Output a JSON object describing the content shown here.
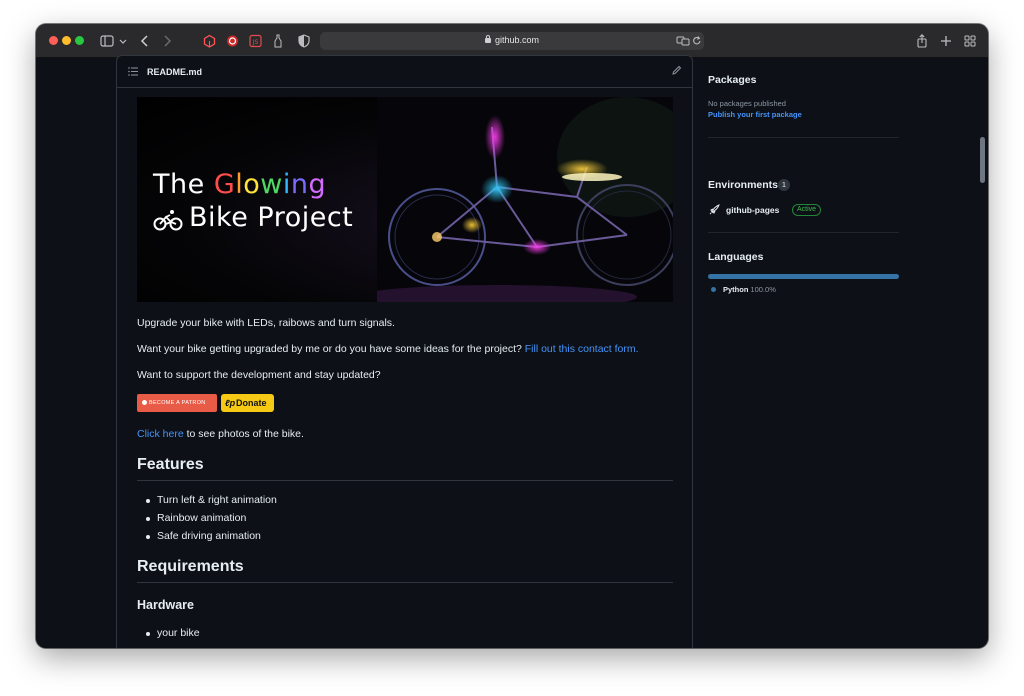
{
  "browser": {
    "url": "github.com"
  },
  "readme": {
    "filename": "README.md",
    "banner": {
      "title_the": "The",
      "title_glowing_letters": [
        "G",
        "l",
        "o",
        "w",
        "i",
        "n",
        "g"
      ],
      "title_line2": "Bike Project"
    },
    "intro": "Upgrade your bike with LEDs, raibows and turn signals.",
    "contact_text": "Want your bike getting upgraded by me or do you have some ideas for the project?",
    "contact_link": "Fill out this contact form.",
    "support_text": "Want to support the development and stay updated?",
    "patron_badge": "BECOME A PATRON",
    "donate_badge": "Donate",
    "photos_link": "Click here",
    "photos_text": "to see photos of the bike.",
    "features_heading": "Features",
    "features": [
      "Turn left & right animation",
      "Rainbow animation",
      "Safe driving animation"
    ],
    "requirements_heading": "Requirements",
    "hardware_heading": "Hardware",
    "hardware": [
      "your bike"
    ]
  },
  "sidebar": {
    "packages_heading": "Packages",
    "packages_empty": "No packages published",
    "packages_link": "Publish your first package",
    "environments_heading": "Environments",
    "environments_count": "1",
    "environment_name": "github-pages",
    "environment_status": "Active",
    "languages_heading": "Languages",
    "language_name": "Python",
    "language_pct": "100.0%",
    "language_color": "#3572a5"
  },
  "colors": {
    "page_bg": "#0d1117",
    "link": "#4493f8",
    "border": "#30363d",
    "glowing": [
      "#ff4d4d",
      "#ff9d2e",
      "#ffe23b",
      "#4cd964",
      "#33b7ff",
      "#7a6bff",
      "#d46bff"
    ]
  }
}
